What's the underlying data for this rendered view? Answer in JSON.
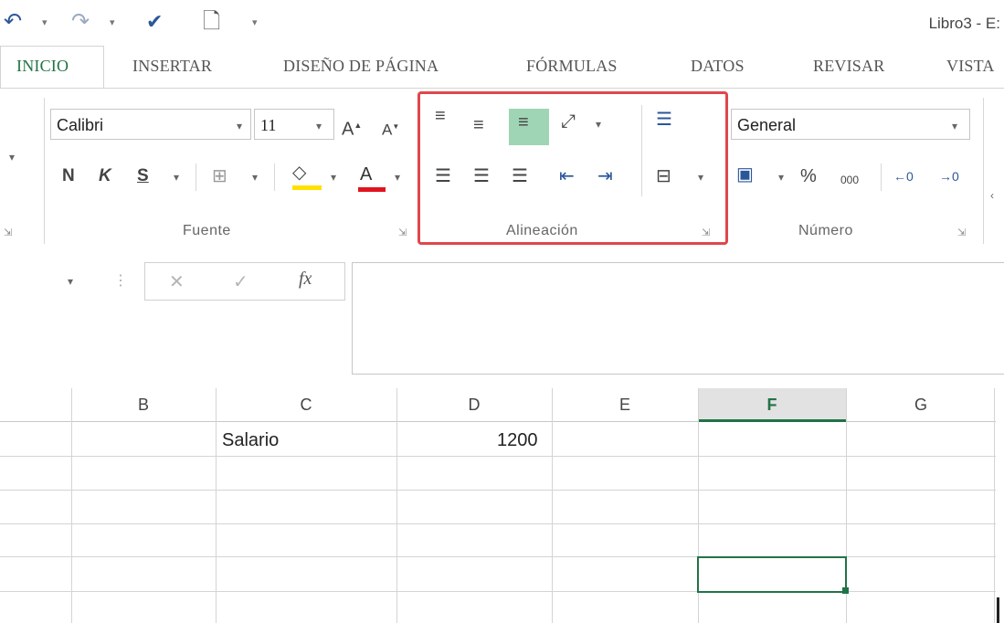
{
  "qat": {
    "undo_icon": "undo-icon",
    "redo_icon": "redo-icon",
    "spelling_icon": "spelling-icon",
    "new_icon": "new-document-icon",
    "customize_icon": "customize-qat-icon"
  },
  "window": {
    "title": "Libro3 - E:"
  },
  "tabs": {
    "inicio": "INICIO",
    "insertar": "INSERTAR",
    "diseno": "DISEÑO DE PÁGINA",
    "formulas": "FÓRMULAS",
    "datos": "DATOS",
    "revisar": "REVISAR",
    "vista": "VISTA"
  },
  "ribbon": {
    "font": {
      "name": "Calibri",
      "size": "11",
      "bold": "N",
      "italic": "K",
      "underline": "S",
      "label": "Fuente"
    },
    "alignment": {
      "label": "Alineación"
    },
    "number": {
      "format": "General",
      "percent": "%",
      "thousands": "000",
      "label": "Número"
    }
  },
  "formula_bar": {
    "fx": "fx",
    "cancel": "✕",
    "enter": "✓"
  },
  "grid": {
    "columns": [
      "B",
      "C",
      "D",
      "E",
      "F",
      "G"
    ],
    "selected_column": "F",
    "cells": {
      "C1": "Salario",
      "D1": "1200"
    }
  },
  "colors": {
    "accent": "#217346",
    "highlight": "#e0474c",
    "brand": "#2b579a"
  }
}
